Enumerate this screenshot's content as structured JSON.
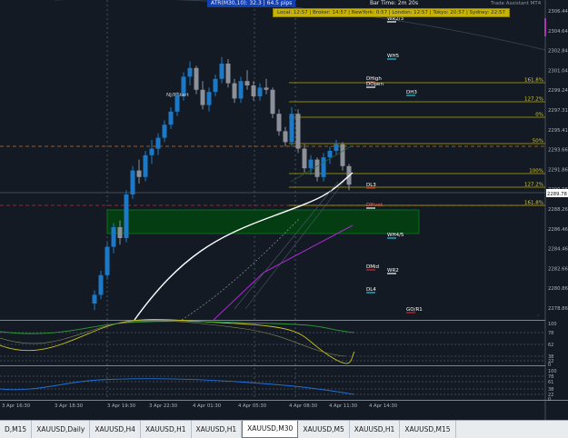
{
  "header": {
    "atr_text": "ATR(M30,10): 32.3   |   64.5 pips",
    "bar_time": "Bar Time: 2m 20s",
    "assistant": "Trade Assistant MT4",
    "sessions": "Local: 12:57 | Broker: 14:57 | NewYork: 0:57 | London: 12:57 | Tokyo: 20:57 | Sydney: 22:57"
  },
  "price_axis": [
    "2306.44",
    "2304.64",
    "2302.84",
    "2301.04",
    "2299.24",
    "2297.31",
    "2295.41",
    "2293.66",
    "2291.86",
    "2290.06",
    "2288.26",
    "2286.46",
    "2284.46",
    "2282.66",
    "2280.86",
    "2278.86"
  ],
  "current_price": "2289.78",
  "fib_labels": [
    {
      "text": "161.8%",
      "price": 2299.05
    },
    {
      "text": "127.2%",
      "price": 2298.05
    },
    {
      "text": "0%",
      "price": 2297.0
    },
    {
      "text": "50%",
      "price": 2294.25
    },
    {
      "text": "100%",
      "price": 2291.9
    },
    {
      "text": "127.2%",
      "price": 2290.45
    },
    {
      "text": "161.8%",
      "price": 2288.65
    }
  ],
  "level_labels": [
    {
      "text": "WR2/3",
      "price": 2305.9,
      "color": "#ffffff"
    },
    {
      "text": "WH5",
      "price": 2302.55,
      "color": "#ffffff"
    },
    {
      "text": "DHigh",
      "price": 2299.35,
      "color": "#ffffff"
    },
    {
      "text": "DOpen",
      "price": 2298.8,
      "color": "#ffffff"
    },
    {
      "text": "DH3",
      "price": 2298.35,
      "color": "#ffffff"
    },
    {
      "text": "DL3",
      "price": 2290.45,
      "color": "#ffffff"
    },
    {
      "text": "DPivot",
      "price": 2288.8,
      "color": "#ff6060"
    },
    {
      "text": "WH4/5",
      "price": 2285.5,
      "color": "#ffffff"
    },
    {
      "text": "DMid",
      "price": 2283.3,
      "color": "#ffffff"
    },
    {
      "text": "WR2",
      "price": 2283.05,
      "color": "#ffffff"
    },
    {
      "text": "DL4",
      "price": 2281.55,
      "color": "#ffffff"
    },
    {
      "text": "GO/R1",
      "price": 2279.6,
      "color": "#ffffff"
    }
  ],
  "start_label": "NJ/RStart",
  "time_axis": [
    "3 Apr 16:30",
    "3 Apr 18:30",
    "3 Apr 19:30",
    "3 Apr 22:30",
    "4 Apr 01:30",
    "4 Apr 05:30",
    "4 Apr 08:30",
    "4 Apr 11:30",
    "4 Apr 14:30"
  ],
  "osc1_axis": [
    "100",
    "78",
    "62",
    "38",
    "22",
    "0"
  ],
  "osc2_axis": [
    "100",
    "78",
    "61",
    "38",
    "22",
    "0"
  ],
  "tabs": [
    {
      "label": "D,M15",
      "active": false
    },
    {
      "label": "XAUUSD,Daily",
      "active": false
    },
    {
      "label": "XAUUSD,H4",
      "active": false
    },
    {
      "label": "XAUUSD,H1",
      "active": false
    },
    {
      "label": "XAUUSD,H1",
      "active": false
    },
    {
      "label": "XAUUSD,M30",
      "active": true
    },
    {
      "label": "XAUUSD,M5",
      "active": false
    },
    {
      "label": "XAUUSD,H1",
      "active": false
    },
    {
      "label": "XAUUSD,M15",
      "active": false
    }
  ],
  "chart_data": {
    "type": "candlestick",
    "symbol": "XAUUSD",
    "timeframe": "M30",
    "ylim": [
      2278.5,
      2307.5
    ],
    "candles": [
      [
        2280.0,
        2281.2,
        2279.4,
        2280.8
      ],
      [
        2280.8,
        2283.0,
        2280.4,
        2282.6
      ],
      [
        2282.6,
        2285.6,
        2282.2,
        2285.2
      ],
      [
        2285.2,
        2287.4,
        2284.6,
        2287.0
      ],
      [
        2287.0,
        2287.6,
        2285.4,
        2286.0
      ],
      [
        2286.0,
        2290.4,
        2285.6,
        2290.0
      ],
      [
        2290.0,
        2292.6,
        2289.6,
        2292.2
      ],
      [
        2292.2,
        2293.2,
        2291.0,
        2291.6
      ],
      [
        2291.6,
        2294.0,
        2291.2,
        2293.6
      ],
      [
        2293.6,
        2295.0,
        2292.8,
        2294.2
      ],
      [
        2294.2,
        2295.6,
        2293.6,
        2295.2
      ],
      [
        2295.2,
        2296.8,
        2294.8,
        2296.4
      ],
      [
        2296.4,
        2298.0,
        2296.0,
        2297.6
      ],
      [
        2297.6,
        2299.4,
        2297.2,
        2299.0
      ],
      [
        2299.0,
        2301.2,
        2298.6,
        2300.8
      ],
      [
        2300.8,
        2302.2,
        2300.0,
        2301.6
      ],
      [
        2301.6,
        2301.8,
        2299.2,
        2299.6
      ],
      [
        2299.6,
        2300.4,
        2297.8,
        2298.2
      ],
      [
        2298.2,
        2299.8,
        2297.6,
        2299.4
      ],
      [
        2299.4,
        2301.0,
        2299.0,
        2300.6
      ],
      [
        2300.6,
        2302.6,
        2300.2,
        2302.0
      ],
      [
        2302.0,
        2302.4,
        2299.8,
        2300.2
      ],
      [
        2300.2,
        2300.6,
        2298.4,
        2298.8
      ],
      [
        2298.8,
        2300.8,
        2298.4,
        2300.4
      ],
      [
        2300.4,
        2301.4,
        2299.6,
        2300.0
      ],
      [
        2300.0,
        2300.4,
        2298.6,
        2299.0
      ],
      [
        2299.0,
        2300.2,
        2298.6,
        2299.8
      ],
      [
        2299.8,
        2300.6,
        2299.2,
        2299.6
      ],
      [
        2299.6,
        2299.8,
        2297.0,
        2297.4
      ],
      [
        2297.4,
        2297.8,
        2295.4,
        2295.8
      ],
      [
        2295.8,
        2296.2,
        2294.4,
        2294.8
      ],
      [
        2294.8,
        2298.0,
        2294.4,
        2297.4
      ],
      [
        2297.4,
        2297.8,
        2293.8,
        2294.2
      ],
      [
        2294.2,
        2294.6,
        2292.0,
        2292.4
      ],
      [
        2292.4,
        2293.6,
        2291.8,
        2293.2
      ],
      [
        2293.2,
        2293.4,
        2291.2,
        2291.6
      ],
      [
        2291.6,
        2293.8,
        2291.2,
        2293.4
      ],
      [
        2293.4,
        2294.4,
        2292.8,
        2294.0
      ],
      [
        2294.0,
        2295.0,
        2293.6,
        2294.6
      ],
      [
        2294.6,
        2294.8,
        2292.2,
        2292.6
      ],
      [
        2292.6,
        2292.8,
        2290.4,
        2290.9
      ]
    ]
  }
}
